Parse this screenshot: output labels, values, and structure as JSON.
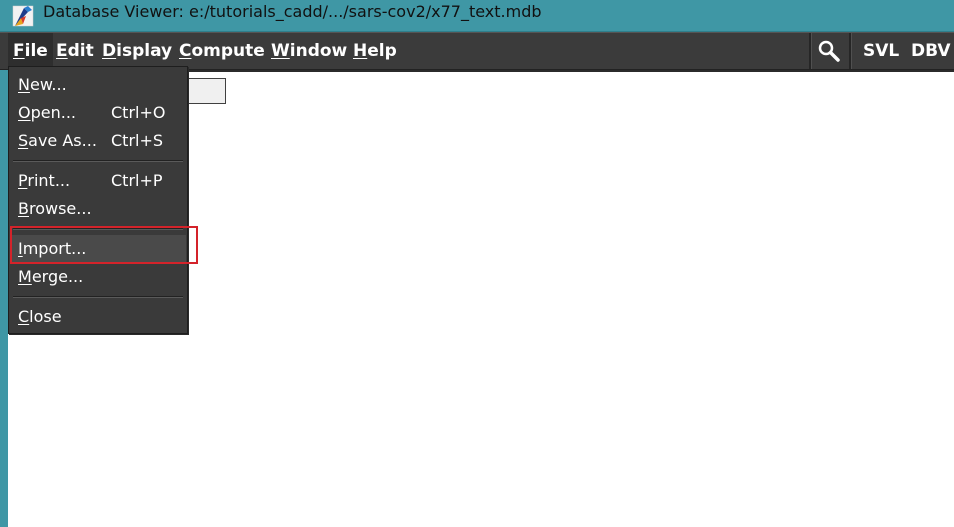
{
  "window": {
    "title": "Database Viewer: e:/tutorials_cadd/.../sars-cov2/x77_text.mdb",
    "app_icon": "app-logo-icon"
  },
  "menubar": {
    "items": [
      {
        "label": "File",
        "mnemonic": "F",
        "rest": "ile"
      },
      {
        "label": "Edit",
        "mnemonic": "E",
        "rest": "dit"
      },
      {
        "label": "Display",
        "mnemonic": "D",
        "rest": "isplay"
      },
      {
        "label": "Compute",
        "mnemonic": "C",
        "rest": "ompute"
      },
      {
        "label": "Window",
        "mnemonic": "W",
        "rest": "indow"
      },
      {
        "label": "Help",
        "mnemonic": "H",
        "rest": "elp"
      }
    ]
  },
  "toolbar": {
    "search_icon": "magnifier-icon",
    "svl_label": "SVL",
    "dbv_label": "DBV"
  },
  "file_menu": {
    "items": [
      {
        "mnemonic": "N",
        "rest": "ew...",
        "shortcut": ""
      },
      {
        "mnemonic": "O",
        "rest": "pen...",
        "shortcut": "Ctrl+O"
      },
      {
        "mnemonic": "S",
        "rest": "ave As...",
        "shortcut": "Ctrl+S"
      },
      {
        "mnemonic": "P",
        "rest": "rint...",
        "shortcut": "Ctrl+P"
      },
      {
        "mnemonic": "B",
        "rest": "rowse...",
        "shortcut": ""
      },
      {
        "mnemonic": "I",
        "rest": "mport...",
        "shortcut": ""
      },
      {
        "mnemonic": "M",
        "rest": "erge...",
        "shortcut": ""
      },
      {
        "mnemonic": "C",
        "rest": "lose",
        "shortcut": ""
      }
    ],
    "highlighted": "Import..."
  },
  "colors": {
    "titlebar": "#3f97a5",
    "menubar": "#3b3b3b",
    "menu_bg": "#3a3a3a",
    "annotation": "#d4232a"
  }
}
